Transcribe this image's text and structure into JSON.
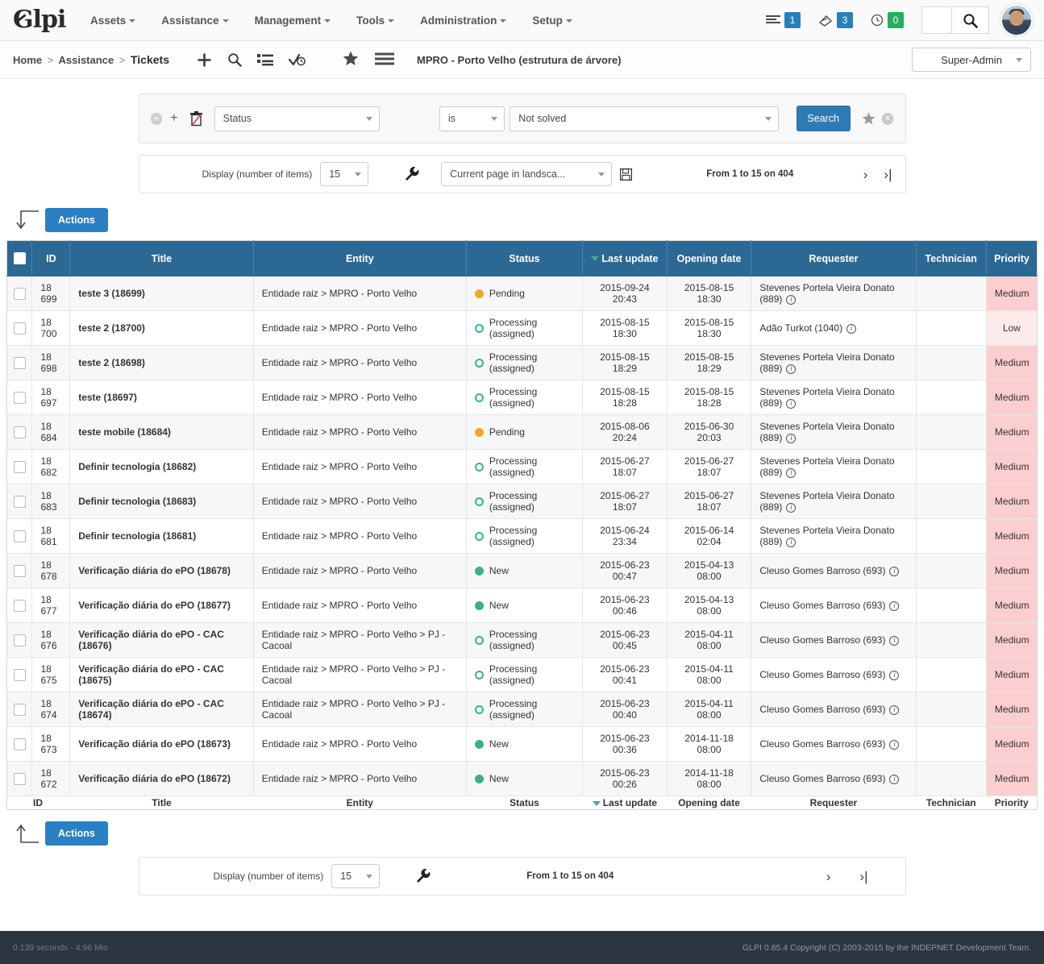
{
  "app": {
    "brand": "Glpi",
    "nav": [
      {
        "label": "Assets"
      },
      {
        "label": "Assistance"
      },
      {
        "label": "Management"
      },
      {
        "label": "Tools"
      },
      {
        "label": "Administration"
      },
      {
        "label": "Setup"
      }
    ],
    "counters": [
      {
        "icon": "list-badge-icon",
        "value": "1",
        "color": "#2980b9"
      },
      {
        "icon": "ticket-badge-icon",
        "value": "3",
        "color": "#2980b9"
      },
      {
        "icon": "clock-badge-icon",
        "value": "0",
        "color": "#27ae60"
      }
    ],
    "global_search": {
      "value": "",
      "placeholder": ""
    },
    "profile": "Super-Admin"
  },
  "breadcrumb": {
    "home": "Home",
    "section": "Assistance",
    "current": "Tickets",
    "separator": ">",
    "entity": "MPRO - Porto Velho (estrutura de árvore)",
    "icons": [
      "plus-icon",
      "search-icon",
      "list-icon",
      "check-clock-icon",
      "star-icon",
      "hamburger-icon"
    ]
  },
  "criteria": {
    "add_group_icon": "plus-circle-icon",
    "add_icon": "plus-icon",
    "delete_icon": "trash-icon",
    "field": "Status",
    "operator": "is",
    "value": "Not solved",
    "search_label": "Search",
    "save_icon": "star-icon",
    "reset_icon": "x-circle-icon"
  },
  "display_bar": {
    "label": "Display (number of items)",
    "count": "15",
    "wrench_icon": "wrench-icon",
    "export": "Current page in landsca...",
    "save_icon": "floppy-icon",
    "pageinfo": "From 1 to 15 on 404",
    "next_icon": "chevron-right-icon",
    "last_icon": "last-page-icon"
  },
  "display_bar_bottom": {
    "label": "Display (number of items)",
    "count": "15",
    "wrench_icon": "wrench-icon",
    "pageinfo": "From 1 to 15 on 404",
    "next_icon": "chevron-right-icon",
    "last_icon": "last-page-icon"
  },
  "actions": {
    "top_label": "Actions",
    "bottom_label": "Actions"
  },
  "table": {
    "columns": [
      {
        "key": "chk",
        "label": ""
      },
      {
        "key": "id",
        "label": "ID"
      },
      {
        "key": "title",
        "label": "Title"
      },
      {
        "key": "ent",
        "label": "Entity"
      },
      {
        "key": "stat",
        "label": "Status"
      },
      {
        "key": "upd",
        "label": "Last update",
        "sorted": "desc"
      },
      {
        "key": "open",
        "label": "Opening date"
      },
      {
        "key": "req",
        "label": "Requester"
      },
      {
        "key": "tech",
        "label": "Technician"
      },
      {
        "key": "prio",
        "label": "Priority"
      }
    ],
    "rows": [
      {
        "id": "18 699",
        "title": "teste 3 (18699)",
        "entity": "Entidade raiz > MPRO - Porto Velho",
        "status": "Pending",
        "status_type": "pending",
        "last_update": "2015-09-24 20:43",
        "opening_date": "2015-08-15 18:30",
        "requester": "Stevenes Portela Vieira Donato (889)",
        "technician": "",
        "priority": "Medium"
      },
      {
        "id": "18 700",
        "title": "teste 2 (18700)",
        "entity": "Entidade raiz > MPRO - Porto Velho",
        "status": "Processing (assigned)",
        "status_type": "proc",
        "last_update": "2015-08-15 18:30",
        "opening_date": "2015-08-15 18:30",
        "requester": "Adão Turkot (1040)",
        "technician": "",
        "priority": "Low"
      },
      {
        "id": "18 698",
        "title": "teste 2 (18698)",
        "entity": "Entidade raiz > MPRO - Porto Velho",
        "status": "Processing (assigned)",
        "status_type": "proc",
        "last_update": "2015-08-15 18:29",
        "opening_date": "2015-08-15 18:29",
        "requester": "Stevenes Portela Vieira Donato (889)",
        "technician": "",
        "priority": "Medium"
      },
      {
        "id": "18 697",
        "title": "teste (18697)",
        "entity": "Entidade raiz > MPRO - Porto Velho",
        "status": "Processing (assigned)",
        "status_type": "proc",
        "last_update": "2015-08-15 18:28",
        "opening_date": "2015-08-15 18:28",
        "requester": "Stevenes Portela Vieira Donato (889)",
        "technician": "",
        "priority": "Medium"
      },
      {
        "id": "18 684",
        "title": "teste mobile (18684)",
        "entity": "Entidade raiz > MPRO - Porto Velho",
        "status": "Pending",
        "status_type": "pending",
        "last_update": "2015-08-06 20:24",
        "opening_date": "2015-06-30 20:03",
        "requester": "Stevenes Portela Vieira Donato (889)",
        "technician": "",
        "priority": "Medium"
      },
      {
        "id": "18 682",
        "title": "Definir tecnologia (18682)",
        "entity": "Entidade raiz > MPRO - Porto Velho",
        "status": "Processing (assigned)",
        "status_type": "proc",
        "last_update": "2015-06-27 18:07",
        "opening_date": "2015-06-27 18:07",
        "requester": "Stevenes Portela Vieira Donato (889)",
        "technician": "",
        "priority": "Medium"
      },
      {
        "id": "18 683",
        "title": "Definir tecnologia (18683)",
        "entity": "Entidade raiz > MPRO - Porto Velho",
        "status": "Processing (assigned)",
        "status_type": "proc",
        "last_update": "2015-06-27 18:07",
        "opening_date": "2015-06-27 18:07",
        "requester": "Stevenes Portela Vieira Donato (889)",
        "technician": "",
        "priority": "Medium"
      },
      {
        "id": "18 681",
        "title": "Definir tecnologia (18681)",
        "entity": "Entidade raiz > MPRO - Porto Velho",
        "status": "Processing (assigned)",
        "status_type": "proc",
        "last_update": "2015-06-24 23:34",
        "opening_date": "2015-06-14 02:04",
        "requester": "Stevenes Portela Vieira Donato (889)",
        "technician": "",
        "priority": "Medium"
      },
      {
        "id": "18 678",
        "title": "Verificação diária do ePO (18678)",
        "entity": "Entidade raiz > MPRO - Porto Velho",
        "status": "New",
        "status_type": "new",
        "last_update": "2015-06-23 00:47",
        "opening_date": "2015-04-13 08:00",
        "requester": "Cleuso Gomes Barroso (693)",
        "technician": "",
        "priority": "Medium"
      },
      {
        "id": "18 677",
        "title": "Verificação diária do ePO (18677)",
        "entity": "Entidade raiz > MPRO - Porto Velho",
        "status": "New",
        "status_type": "new",
        "last_update": "2015-06-23 00:46",
        "opening_date": "2015-04-13 08:00",
        "requester": "Cleuso Gomes Barroso (693)",
        "technician": "",
        "priority": "Medium"
      },
      {
        "id": "18 676",
        "title": "Verificação diária do ePO - CAC (18676)",
        "entity": "Entidade raiz > MPRO - Porto Velho > PJ - Cacoal",
        "status": "Processing (assigned)",
        "status_type": "proc",
        "last_update": "2015-06-23 00:45",
        "opening_date": "2015-04-11 08:00",
        "requester": "Cleuso Gomes Barroso (693)",
        "technician": "",
        "priority": "Medium"
      },
      {
        "id": "18 675",
        "title": "Verificação diária do ePO - CAC (18675)",
        "entity": "Entidade raiz > MPRO - Porto Velho > PJ - Cacoal",
        "status": "Processing (assigned)",
        "status_type": "proc",
        "last_update": "2015-06-23 00:41",
        "opening_date": "2015-04-11 08:00",
        "requester": "Cleuso Gomes Barroso (693)",
        "technician": "",
        "priority": "Medium"
      },
      {
        "id": "18 674",
        "title": "Verificação diária do ePO - CAC (18674)",
        "entity": "Entidade raiz > MPRO - Porto Velho > PJ - Cacoal",
        "status": "Processing (assigned)",
        "status_type": "proc",
        "last_update": "2015-06-23 00:40",
        "opening_date": "2015-04-11 08:00",
        "requester": "Cleuso Gomes Barroso (693)",
        "technician": "",
        "priority": "Medium"
      },
      {
        "id": "18 673",
        "title": "Verificação diária do ePO (18673)",
        "entity": "Entidade raiz > MPRO - Porto Velho",
        "status": "New",
        "status_type": "new",
        "last_update": "2015-06-23 00:36",
        "opening_date": "2014-11-18 08:00",
        "requester": "Cleuso Gomes Barroso (693)",
        "technician": "",
        "priority": "Medium"
      },
      {
        "id": "18 672",
        "title": "Verificação diária do ePO (18672)",
        "entity": "Entidade raiz > MPRO - Porto Velho",
        "status": "New",
        "status_type": "new",
        "last_update": "2015-06-23 00:26",
        "opening_date": "2014-11-18 08:00",
        "requester": "Cleuso Gomes Barroso (693)",
        "technician": "",
        "priority": "Medium"
      }
    ]
  },
  "footer": {
    "left": "0.139 seconds - 4.96 Mio",
    "right": "GLPI 0.85.4 Copyright (C) 2003-2015 by the INDEPNET Development Team."
  },
  "colors": {
    "header_blue": "#2c6894",
    "button_blue": "#2b7fc3",
    "search_blue": "#2d7bb5",
    "status_pending": "#f5a623",
    "status_green": "#3bb08f",
    "priority_medium": "#fbcfcf",
    "priority_low": "#fdebeb",
    "footer_bg": "#2b3640"
  }
}
